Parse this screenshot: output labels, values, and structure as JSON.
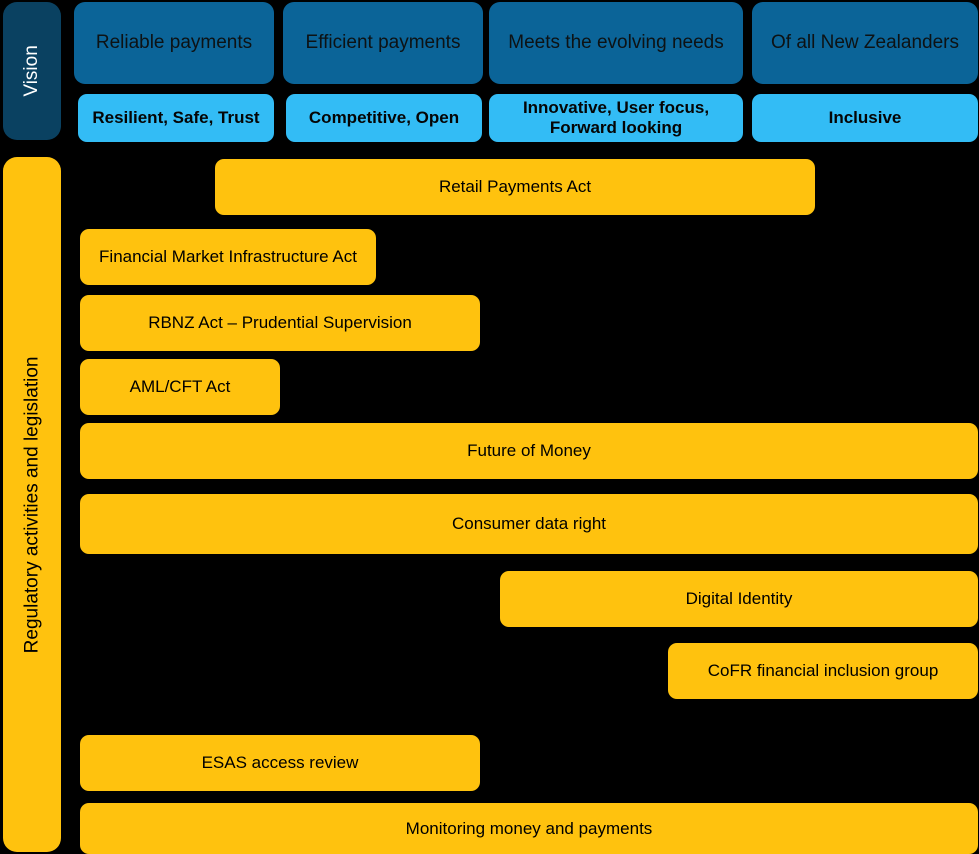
{
  "diagram": {
    "title": "Payments vision and regulatory activities",
    "colors": {
      "background": "#000000",
      "vision_label": "#0a4161",
      "vision_pillar": "#0b6498",
      "vision_attribute": "#33bcf5",
      "regulatory": "#ffc20e",
      "text_dark": "#000000",
      "text_light": "#ffffff"
    }
  },
  "vision_section": {
    "label": "Vision",
    "pillars": [
      {
        "label": "Reliable payments"
      },
      {
        "label": "Efficient payments"
      },
      {
        "label": "Meets the evolving needs"
      },
      {
        "label": "Of all New Zealanders"
      }
    ],
    "attributes": [
      {
        "label": "Resilient, Safe, Trust"
      },
      {
        "label": "Competitive, Open"
      },
      {
        "label": "Innovative, User focus, Forward looking"
      },
      {
        "label": "Inclusive"
      }
    ]
  },
  "regulatory_section": {
    "label": "Regulatory activities and legislation",
    "activities": [
      {
        "label": "Retail Payments Act"
      },
      {
        "label": "Financial Market Infrastructure Act"
      },
      {
        "label": "RBNZ Act – Prudential Supervision"
      },
      {
        "label": "AML/CFT Act"
      },
      {
        "label": "Future of Money"
      },
      {
        "label": "Consumer data right"
      },
      {
        "label": "Digital Identity"
      },
      {
        "label": "CoFR financial inclusion group"
      },
      {
        "label": "ESAS access review"
      },
      {
        "label": "Monitoring money and payments"
      }
    ]
  }
}
